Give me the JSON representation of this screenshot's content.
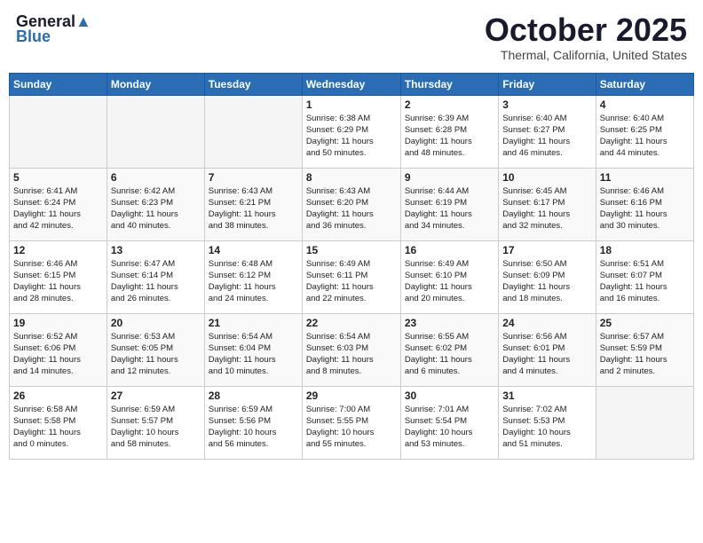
{
  "header": {
    "logo_line1": "General",
    "logo_line2": "Blue",
    "title": "October 2025",
    "subtitle": "Thermal, California, United States"
  },
  "weekdays": [
    "Sunday",
    "Monday",
    "Tuesday",
    "Wednesday",
    "Thursday",
    "Friday",
    "Saturday"
  ],
  "weeks": [
    [
      {
        "day": "",
        "info": ""
      },
      {
        "day": "",
        "info": ""
      },
      {
        "day": "",
        "info": ""
      },
      {
        "day": "1",
        "info": "Sunrise: 6:38 AM\nSunset: 6:29 PM\nDaylight: 11 hours\nand 50 minutes."
      },
      {
        "day": "2",
        "info": "Sunrise: 6:39 AM\nSunset: 6:28 PM\nDaylight: 11 hours\nand 48 minutes."
      },
      {
        "day": "3",
        "info": "Sunrise: 6:40 AM\nSunset: 6:27 PM\nDaylight: 11 hours\nand 46 minutes."
      },
      {
        "day": "4",
        "info": "Sunrise: 6:40 AM\nSunset: 6:25 PM\nDaylight: 11 hours\nand 44 minutes."
      }
    ],
    [
      {
        "day": "5",
        "info": "Sunrise: 6:41 AM\nSunset: 6:24 PM\nDaylight: 11 hours\nand 42 minutes."
      },
      {
        "day": "6",
        "info": "Sunrise: 6:42 AM\nSunset: 6:23 PM\nDaylight: 11 hours\nand 40 minutes."
      },
      {
        "day": "7",
        "info": "Sunrise: 6:43 AM\nSunset: 6:21 PM\nDaylight: 11 hours\nand 38 minutes."
      },
      {
        "day": "8",
        "info": "Sunrise: 6:43 AM\nSunset: 6:20 PM\nDaylight: 11 hours\nand 36 minutes."
      },
      {
        "day": "9",
        "info": "Sunrise: 6:44 AM\nSunset: 6:19 PM\nDaylight: 11 hours\nand 34 minutes."
      },
      {
        "day": "10",
        "info": "Sunrise: 6:45 AM\nSunset: 6:17 PM\nDaylight: 11 hours\nand 32 minutes."
      },
      {
        "day": "11",
        "info": "Sunrise: 6:46 AM\nSunset: 6:16 PM\nDaylight: 11 hours\nand 30 minutes."
      }
    ],
    [
      {
        "day": "12",
        "info": "Sunrise: 6:46 AM\nSunset: 6:15 PM\nDaylight: 11 hours\nand 28 minutes."
      },
      {
        "day": "13",
        "info": "Sunrise: 6:47 AM\nSunset: 6:14 PM\nDaylight: 11 hours\nand 26 minutes."
      },
      {
        "day": "14",
        "info": "Sunrise: 6:48 AM\nSunset: 6:12 PM\nDaylight: 11 hours\nand 24 minutes."
      },
      {
        "day": "15",
        "info": "Sunrise: 6:49 AM\nSunset: 6:11 PM\nDaylight: 11 hours\nand 22 minutes."
      },
      {
        "day": "16",
        "info": "Sunrise: 6:49 AM\nSunset: 6:10 PM\nDaylight: 11 hours\nand 20 minutes."
      },
      {
        "day": "17",
        "info": "Sunrise: 6:50 AM\nSunset: 6:09 PM\nDaylight: 11 hours\nand 18 minutes."
      },
      {
        "day": "18",
        "info": "Sunrise: 6:51 AM\nSunset: 6:07 PM\nDaylight: 11 hours\nand 16 minutes."
      }
    ],
    [
      {
        "day": "19",
        "info": "Sunrise: 6:52 AM\nSunset: 6:06 PM\nDaylight: 11 hours\nand 14 minutes."
      },
      {
        "day": "20",
        "info": "Sunrise: 6:53 AM\nSunset: 6:05 PM\nDaylight: 11 hours\nand 12 minutes."
      },
      {
        "day": "21",
        "info": "Sunrise: 6:54 AM\nSunset: 6:04 PM\nDaylight: 11 hours\nand 10 minutes."
      },
      {
        "day": "22",
        "info": "Sunrise: 6:54 AM\nSunset: 6:03 PM\nDaylight: 11 hours\nand 8 minutes."
      },
      {
        "day": "23",
        "info": "Sunrise: 6:55 AM\nSunset: 6:02 PM\nDaylight: 11 hours\nand 6 minutes."
      },
      {
        "day": "24",
        "info": "Sunrise: 6:56 AM\nSunset: 6:01 PM\nDaylight: 11 hours\nand 4 minutes."
      },
      {
        "day": "25",
        "info": "Sunrise: 6:57 AM\nSunset: 5:59 PM\nDaylight: 11 hours\nand 2 minutes."
      }
    ],
    [
      {
        "day": "26",
        "info": "Sunrise: 6:58 AM\nSunset: 5:58 PM\nDaylight: 11 hours\nand 0 minutes."
      },
      {
        "day": "27",
        "info": "Sunrise: 6:59 AM\nSunset: 5:57 PM\nDaylight: 10 hours\nand 58 minutes."
      },
      {
        "day": "28",
        "info": "Sunrise: 6:59 AM\nSunset: 5:56 PM\nDaylight: 10 hours\nand 56 minutes."
      },
      {
        "day": "29",
        "info": "Sunrise: 7:00 AM\nSunset: 5:55 PM\nDaylight: 10 hours\nand 55 minutes."
      },
      {
        "day": "30",
        "info": "Sunrise: 7:01 AM\nSunset: 5:54 PM\nDaylight: 10 hours\nand 53 minutes."
      },
      {
        "day": "31",
        "info": "Sunrise: 7:02 AM\nSunset: 5:53 PM\nDaylight: 10 hours\nand 51 minutes."
      },
      {
        "day": "",
        "info": ""
      }
    ]
  ]
}
